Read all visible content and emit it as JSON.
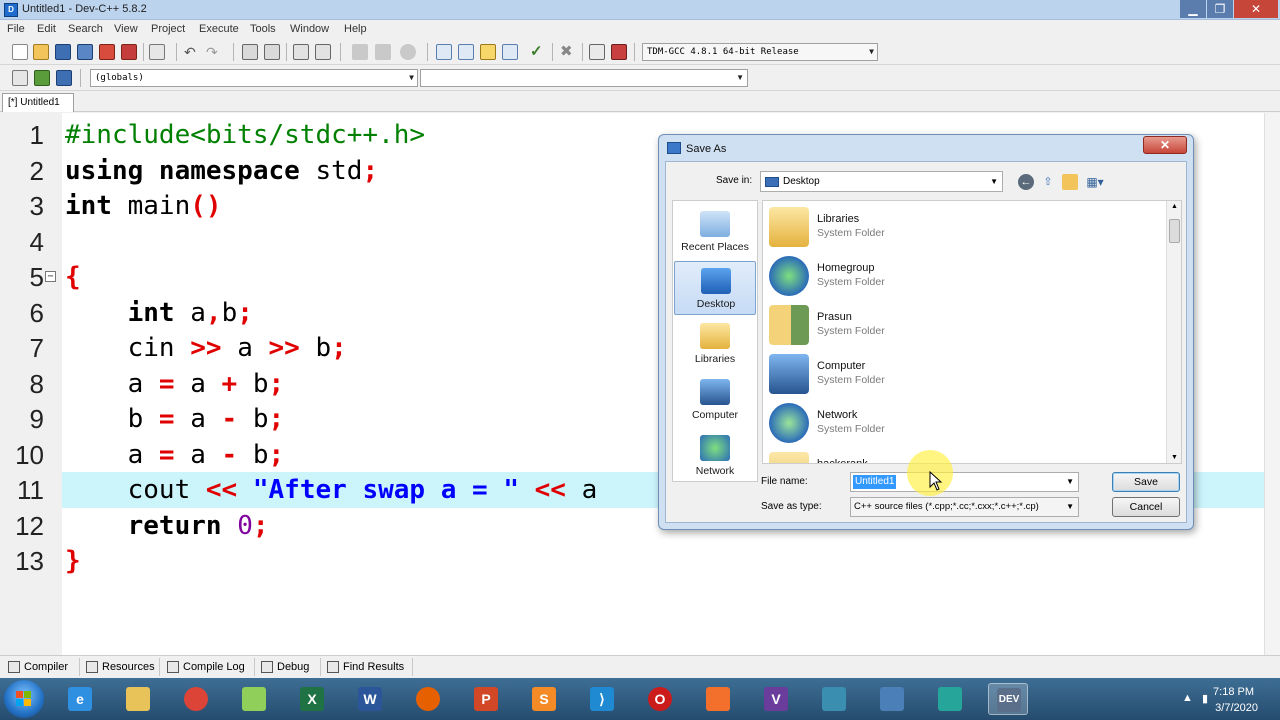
{
  "window": {
    "title": "Untitled1 - Dev-C++ 5.8.2",
    "app_icon": "dev-cpp-icon"
  },
  "menu": [
    "File",
    "Edit",
    "Search",
    "View",
    "Project",
    "Execute",
    "Tools",
    "Window",
    "Help"
  ],
  "toolbar": {
    "compiler": "TDM-GCC 4.8.1 64-bit Release",
    "scope": "(globals)",
    "symbol": ""
  },
  "editor": {
    "tab": "[*] Untitled1",
    "current_line": 11,
    "lines": [
      {
        "n": "1",
        "parts": [
          "#include<bits/stdc++.h>"
        ]
      },
      {
        "n": "2",
        "parts": [
          "using namespace",
          " std",
          ";"
        ]
      },
      {
        "n": "3",
        "parts": [
          "int",
          " main",
          "()"
        ]
      },
      {
        "n": "4",
        "parts": []
      },
      {
        "n": "5",
        "parts": [
          "{"
        ]
      },
      {
        "n": "6",
        "parts": [
          "    ",
          "int",
          " a",
          ",",
          "b",
          ";"
        ]
      },
      {
        "n": "7",
        "parts": [
          "    ",
          "cin",
          " >> ",
          "a",
          " >> ",
          "b",
          ";"
        ]
      },
      {
        "n": "8",
        "parts": [
          "    ",
          "a",
          " = ",
          "a",
          " + ",
          "b",
          ";"
        ]
      },
      {
        "n": "9",
        "parts": [
          "    ",
          "b",
          " = ",
          "a",
          " - ",
          "b",
          ";"
        ]
      },
      {
        "n": "10",
        "parts": [
          "    ",
          "a",
          " = ",
          "a",
          " - ",
          "b",
          ";"
        ]
      },
      {
        "n": "11",
        "parts": [
          "    ",
          "cout",
          " << ",
          "\"After swap a = \"",
          " << ",
          "a"
        ]
      },
      {
        "n": "12",
        "parts": [
          "    ",
          "return",
          " ",
          "0",
          ";"
        ]
      },
      {
        "n": "13",
        "parts": [
          "}"
        ]
      }
    ]
  },
  "bottom_tabs": [
    "Compiler",
    "Resources",
    "Compile Log",
    "Debug",
    "Find Results"
  ],
  "dialog": {
    "title": "Save As",
    "save_in_label": "Save in:",
    "save_in_value": "Desktop",
    "places": [
      "Recent Places",
      "Desktop",
      "Libraries",
      "Computer",
      "Network"
    ],
    "selected_place": "Desktop",
    "items": [
      {
        "name": "Libraries",
        "type": "System Folder"
      },
      {
        "name": "Homegroup",
        "type": "System Folder"
      },
      {
        "name": "Prasun",
        "type": "System Folder"
      },
      {
        "name": "Computer",
        "type": "System Folder"
      },
      {
        "name": "Network",
        "type": "System Folder"
      },
      {
        "name": "hackerank",
        "type": ""
      }
    ],
    "file_name_label": "File name:",
    "file_name_value": "Untitled1",
    "save_as_type_label": "Save as type:",
    "save_as_type_value": "C++ source files (*.cpp;*.cc;*.cxx;*.c++;*.cp)",
    "save_button": "Save",
    "cancel_button": "Cancel"
  },
  "taskbar": {
    "apps": [
      "internet-explorer",
      "file-explorer",
      "chrome",
      "notepad-plus-plus",
      "excel",
      "word",
      "firefox",
      "powerpoint",
      "sublime-text",
      "vscode",
      "opera",
      "paint",
      "visual-studio",
      "bluej",
      "remote-desktop",
      "camtasia",
      "dev-cpp"
    ],
    "time": "7:18 PM",
    "date": "3/7/2020"
  },
  "colors": {
    "keyword": "#000000",
    "operator": "#e00000",
    "preprocessor": "#008000",
    "string": "#0000ff",
    "number": "#8000a0",
    "current_line": "#ccf4fb"
  }
}
